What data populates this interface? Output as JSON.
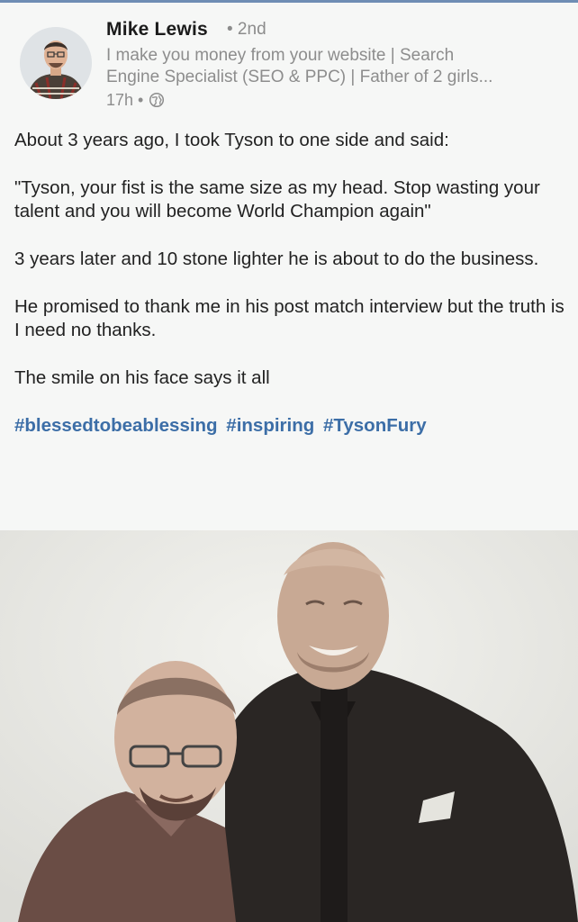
{
  "author": {
    "name": "Mike Lewis",
    "degree": "• 2nd",
    "headline_line1": "I make you money from your website | Search",
    "headline_line2": "Engine Specialist (SEO & PPC) | Father of 2 girls...",
    "time": "17h •"
  },
  "post": {
    "paragraphs": [
      "About 3 years ago, I took Tyson to one side and said:",
      "\"Tyson, your fist is the same size as my head. Stop wasting your talent and you will become World Champion again\"",
      "3 years later and 10 stone lighter he is about to do the business.",
      "He promised to thank me in his post match interview but the truth is I need no thanks.",
      "The smile on his face says it all"
    ],
    "hashtags": [
      "#blessedtobeablessing",
      "#inspiring",
      "#TysonFury"
    ]
  },
  "colors": {
    "hashtag": "#3c6ea7",
    "body_text": "#222222",
    "meta_text": "#8d8d8d",
    "top_border": "#6f8db4"
  },
  "icons": {
    "visibility": "globe-icon",
    "avatar": "profile-photo"
  }
}
